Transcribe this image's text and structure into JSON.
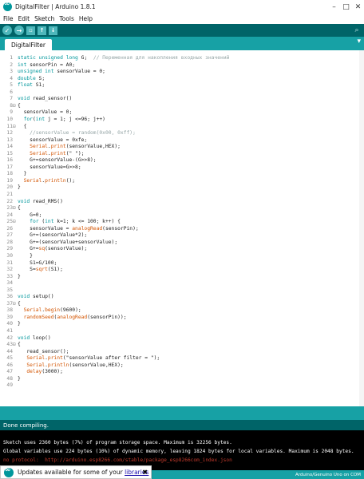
{
  "window": {
    "title": "DigitalFilter | Arduino 1.8.1"
  },
  "menu": [
    "File",
    "Edit",
    "Sketch",
    "Tools",
    "Help"
  ],
  "tabs": [
    {
      "label": "DigitalFilter"
    }
  ],
  "editor": {
    "lines": [
      {
        "n": "1",
        "fold": "",
        "code": "static unsigned long G;  // Переменная для накопления входных значений"
      },
      {
        "n": "2",
        "fold": "",
        "code": "int sensorPin = A0;"
      },
      {
        "n": "3",
        "fold": "",
        "code": "unsigned int sensorValue = 0;"
      },
      {
        "n": "4",
        "fold": "",
        "code": "double S;"
      },
      {
        "n": "5",
        "fold": "",
        "code": "float S1;"
      },
      {
        "n": "6",
        "fold": "",
        "code": ""
      },
      {
        "n": "7",
        "fold": "",
        "code": "void read_sensor()"
      },
      {
        "n": "8",
        "fold": "⊟",
        "code": "{"
      },
      {
        "n": "9",
        "fold": "",
        "code": "  sensorValue = 0;"
      },
      {
        "n": "10",
        "fold": "",
        "code": "  for(int j = 1; j <=96; j++)"
      },
      {
        "n": "11",
        "fold": "⊟",
        "code": "  {"
      },
      {
        "n": "12",
        "fold": "",
        "code": "    //sensorValue = random(0x00, 0xff);"
      },
      {
        "n": "13",
        "fold": "",
        "code": "    sensorValue = 0xfe;"
      },
      {
        "n": "14",
        "fold": "",
        "code": "    Serial.print(sensorValue,HEX);"
      },
      {
        "n": "15",
        "fold": "",
        "code": "    Serial.print(\" \");"
      },
      {
        "n": "16",
        "fold": "",
        "code": "    G+=sensorValue-(G>>8);"
      },
      {
        "n": "17",
        "fold": "",
        "code": "    sensorValue=G>>8;"
      },
      {
        "n": "18",
        "fold": "",
        "code": "  }"
      },
      {
        "n": "19",
        "fold": "",
        "code": "  Serial.println();"
      },
      {
        "n": "20",
        "fold": "",
        "code": "}"
      },
      {
        "n": "21",
        "fold": "",
        "code": ""
      },
      {
        "n": "22",
        "fold": "",
        "code": "void read_RMS()"
      },
      {
        "n": "23",
        "fold": "⊟",
        "code": "{"
      },
      {
        "n": "24",
        "fold": "",
        "code": "    G=0;"
      },
      {
        "n": "25",
        "fold": "⊟",
        "code": "    for (int k=1; k <= 100; k++) {"
      },
      {
        "n": "26",
        "fold": "",
        "code": "    sensorValue = analogRead(sensorPin);"
      },
      {
        "n": "27",
        "fold": "",
        "code": "    G+=(sensorValue*2);"
      },
      {
        "n": "28",
        "fold": "",
        "code": "    G+=(sensorValue+sensorValue);"
      },
      {
        "n": "29",
        "fold": "",
        "code": "    G+=sq(sensorValue);"
      },
      {
        "n": "30",
        "fold": "",
        "code": "    }"
      },
      {
        "n": "31",
        "fold": "",
        "code": "    S1=G/100;"
      },
      {
        "n": "32",
        "fold": "",
        "code": "    S=sqrt(S1);"
      },
      {
        "n": "33",
        "fold": "",
        "code": "}"
      },
      {
        "n": "34",
        "fold": "",
        "code": ""
      },
      {
        "n": "35",
        "fold": "",
        "code": ""
      },
      {
        "n": "36",
        "fold": "",
        "code": "void setup()"
      },
      {
        "n": "37",
        "fold": "⊟",
        "code": "{"
      },
      {
        "n": "38",
        "fold": "",
        "code": "  Serial.begin(9600);"
      },
      {
        "n": "39",
        "fold": "",
        "code": "  randomSeed(analogRead(sensorPin));"
      },
      {
        "n": "40",
        "fold": "",
        "code": "}"
      },
      {
        "n": "41",
        "fold": "",
        "code": ""
      },
      {
        "n": "42",
        "fold": "",
        "code": "void loop()"
      },
      {
        "n": "43",
        "fold": "⊟",
        "code": "{"
      },
      {
        "n": "44",
        "fold": "",
        "code": "   read_sensor();"
      },
      {
        "n": "45",
        "fold": "",
        "code": "   Serial.print(\"sensorValue after filter = \");"
      },
      {
        "n": "46",
        "fold": "",
        "code": "   Serial.println(sensorValue,HEX);"
      },
      {
        "n": "47",
        "fold": "",
        "code": "   delay(3000);"
      },
      {
        "n": "48",
        "fold": "",
        "code": "}"
      },
      {
        "n": "49",
        "fold": "",
        "code": ""
      }
    ]
  },
  "status": {
    "message": "Done compiling."
  },
  "console": {
    "lines": [
      {
        "text": "Sketch uses 2360 bytes (7%) of program storage space. Maximum is 32256 bytes.",
        "kind": "normal"
      },
      {
        "text": "Global variables use 224 bytes (10%) of dynamic memory, leaving 1824 bytes for local variables. Maximum is 2048 bytes.",
        "kind": "normal"
      },
      {
        "text": "no protocol:  http://arduino.esp8266.com/stable/package_esp8266com_index.json",
        "kind": "error"
      }
    ]
  },
  "bottom_status": {
    "board": "Arduino/Genuino Uno on COM"
  },
  "notification": {
    "prefix": "Updates available for some of your ",
    "link": "libraries",
    "close": "✖"
  },
  "colors": {
    "teal_dark": "#006468",
    "teal": "#17a1a5",
    "keyword": "#00979c",
    "function": "#d35400"
  }
}
